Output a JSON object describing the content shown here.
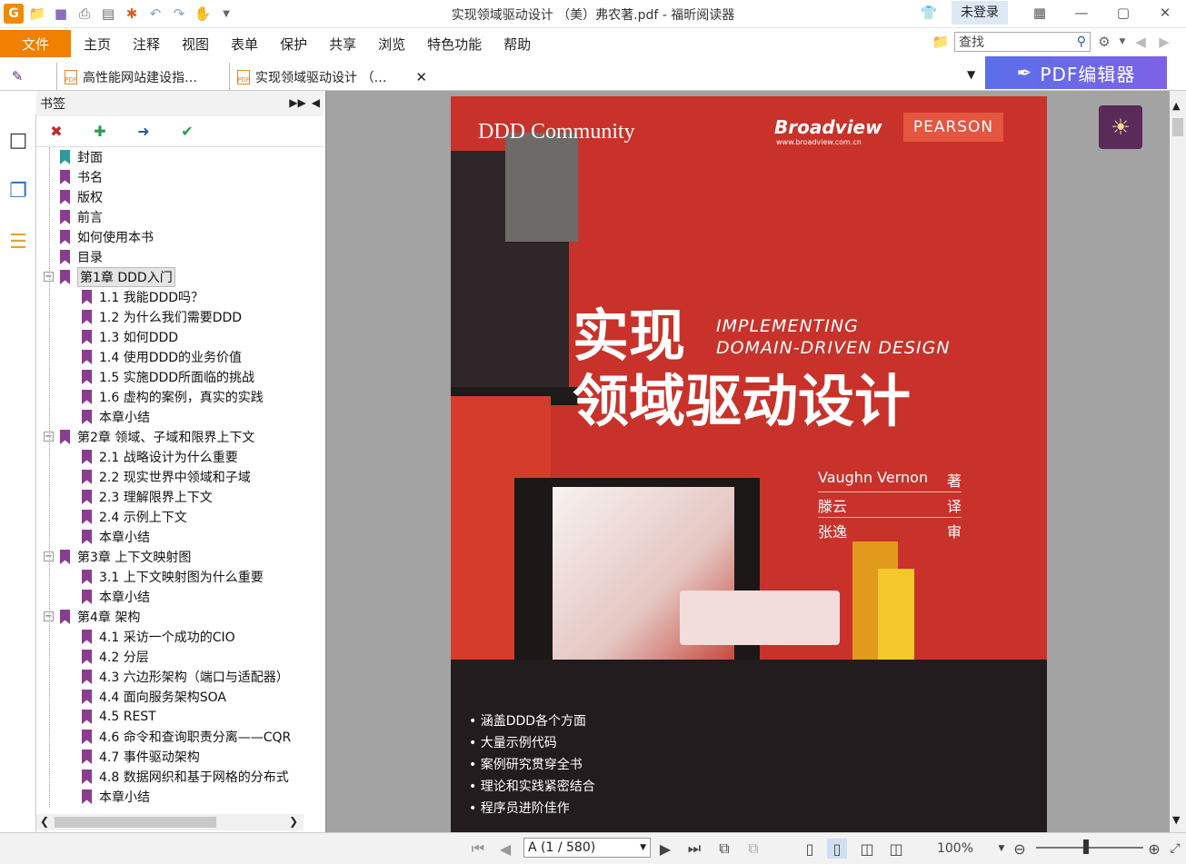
{
  "window": {
    "title": "实现领域驱动设计 （美）弗农著.pdf - 福昕阅读器",
    "app_logo_letter": "G",
    "login_label": "未登录",
    "controls": [
      "restore-layout",
      "minimize",
      "maximize",
      "close"
    ]
  },
  "quick_access": [
    "open-folder-icon",
    "save-icon",
    "print-icon",
    "doc-icon",
    "new-icon",
    "undo-icon",
    "redo-icon",
    "hand-tool-icon",
    "customize-icon"
  ],
  "menu": {
    "file": "文件",
    "items": [
      "主页",
      "注释",
      "视图",
      "表单",
      "保护",
      "共享",
      "浏览",
      "特色功能",
      "帮助"
    ],
    "search_placeholder": "查找"
  },
  "tabs": [
    {
      "label": "高性能网站建设指…",
      "active": false
    },
    {
      "label": "实现领域驱动设计 （…",
      "active": true
    }
  ],
  "pdf_editor_button": "PDF编辑器",
  "bookmarks": {
    "title": "书签",
    "items": [
      {
        "label": "封面",
        "level": 0,
        "teal": true
      },
      {
        "label": "书名",
        "level": 0
      },
      {
        "label": "版权",
        "level": 0
      },
      {
        "label": "前言",
        "level": 0
      },
      {
        "label": "如何使用本书",
        "level": 0
      },
      {
        "label": "目录",
        "level": 0
      },
      {
        "label": "第1章 DDD入门",
        "level": 0,
        "expanded": true,
        "selected": true
      },
      {
        "label": "1.1 我能DDD吗？",
        "level": 1
      },
      {
        "label": "1.2 为什么我们需要DDD",
        "level": 1
      },
      {
        "label": "1.3 如何DDD",
        "level": 1
      },
      {
        "label": "1.4 使用DDD的业务价值",
        "level": 1
      },
      {
        "label": "1.5 实施DDD所面临的挑战",
        "level": 1
      },
      {
        "label": "1.6 虚构的案例，真实的实践",
        "level": 1
      },
      {
        "label": "本章小结",
        "level": 1
      },
      {
        "label": "第2章 领域、子域和限界上下文",
        "level": 0,
        "expanded": true
      },
      {
        "label": "2.1 战略设计为什么重要",
        "level": 1
      },
      {
        "label": "2.2 现实世界中领域和子域",
        "level": 1
      },
      {
        "label": "2.3 理解限界上下文",
        "level": 1
      },
      {
        "label": "2.4 示例上下文",
        "level": 1
      },
      {
        "label": "本章小结",
        "level": 1
      },
      {
        "label": "第3章 上下文映射图",
        "level": 0,
        "expanded": true
      },
      {
        "label": "3.1 上下文映射图为什么重要",
        "level": 1
      },
      {
        "label": "本章小结",
        "level": 1
      },
      {
        "label": "第4章 架构",
        "level": 0,
        "expanded": true
      },
      {
        "label": "4.1 采访一个成功的CIO",
        "level": 1
      },
      {
        "label": "4.2 分层",
        "level": 1
      },
      {
        "label": "4.3 六边形架构（端口与适配器）",
        "level": 1
      },
      {
        "label": "4.4 面向服务架构SOA",
        "level": 1
      },
      {
        "label": "4.5 REST",
        "level": 1
      },
      {
        "label": "4.6 命令和查询职责分离——CQR",
        "level": 1
      },
      {
        "label": "4.7 事件驱动架构",
        "level": 1
      },
      {
        "label": "4.8 数据网织和基于网格的分布式",
        "level": 1
      },
      {
        "label": "本章小结",
        "level": 1
      }
    ]
  },
  "cover": {
    "community_logo": "DDD Community",
    "broadview": "Broadview",
    "broadview_url": "www.broadview.com.cn",
    "pearson": "PEARSON",
    "title_line1": "实现",
    "title_line2": "领域驱动设计",
    "english_line1": "IMPLEMENTING",
    "english_line2": "DOMAIN-DRIVEN DESIGN",
    "credits": [
      {
        "name": "Vaughn Vernon",
        "role": "著"
      },
      {
        "name": "滕云",
        "role": "译"
      },
      {
        "name": "张逸",
        "role": "审"
      }
    ],
    "bullets": [
      "• 涵盖DDD各个方面",
      "• 大量示例代码",
      "• 案例研究贯穿全书",
      "• 理论和实践紧密结合",
      "• 程序员进阶佳作"
    ]
  },
  "status": {
    "page_indicator": "A (1 / 580)",
    "zoom": "100%"
  }
}
